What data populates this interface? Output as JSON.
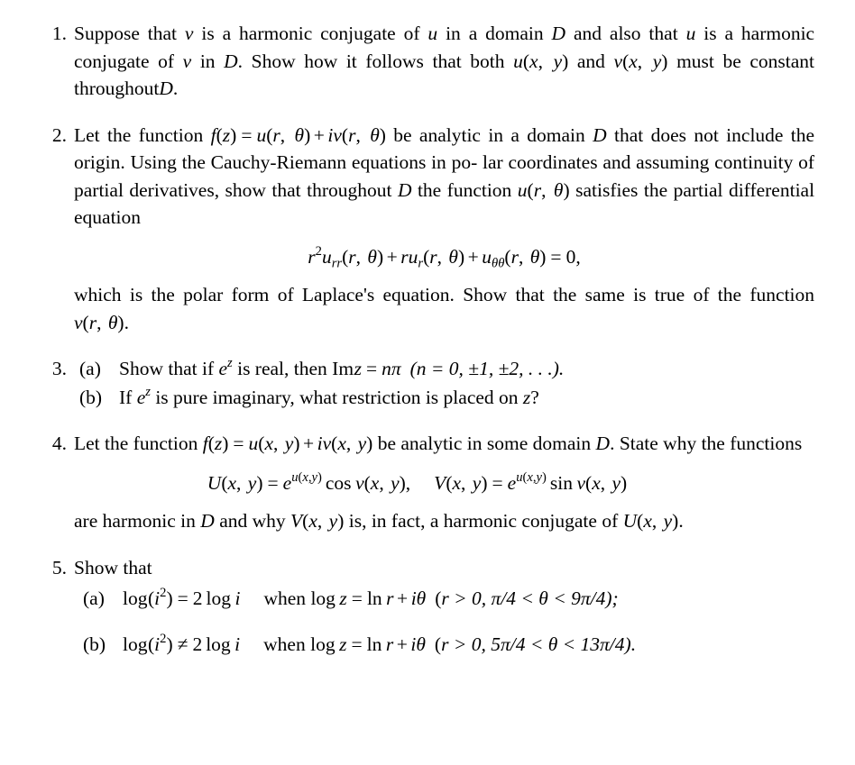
{
  "document": {
    "type": "math-problem-set",
    "subject": "complex-analysis",
    "background_color": "#ffffff",
    "text_color": "#000000"
  },
  "problems": [
    {
      "number": "1.",
      "text_plain": "Suppose that v is a harmonic conjugate of u in a domain D and also that u is a harmonic conjugate of v in D. Show how it follows that both u(x, y) and v(x, y) must be constant throughout D.",
      "lines": [
        "Suppose that v is a harmonic conjugate of u in a domain D and also that",
        "u is a harmonic conjugate of v in D. Show how it follows that both u(x, y)",
        "and v(x, y) must be constant throughout D."
      ],
      "segments": {
        "l1_a": "Suppose that",
        "l1_v": "v",
        "l1_b": "is a harmonic conjugate of",
        "l1_u": "u",
        "l1_c": "in a domain",
        "l1_D": "D",
        "l1_d": "and also that",
        "l2_u": "u",
        "l2_a": "is a harmonic conjugate of",
        "l2_v": "v",
        "l2_b": "in",
        "l2_D": "D",
        "l2_c": ". Show how it follows that both",
        "l3_a": "and",
        "l3_b": "must be constant throughout",
        "l3_D": "D",
        "l3_period": "."
      }
    },
    {
      "number": "2.",
      "text_plain": "Let the function f(z) = u(r, θ) + iv(r, θ) be analytic in a domain D that does not include the origin. Using the Cauchy-Riemann equations in polar coordinates and assuming continuity of partial derivatives, show that throughout D the function u(r, θ) satisfies the partial differential equation",
      "segments": {
        "s1": "Let the function",
        "s2": "be analytic in a domain",
        "s3": "D",
        "s4": "that does not include the origin. Using the Cauchy-Riemann equations in po-",
        "s5": "lar coordinates and assuming continuity of partial derivatives, show that",
        "s6": "throughout",
        "s7": "D",
        "s8": "the function",
        "s9": "satisfies the partial differential equation"
      },
      "equation_plain": "r²u_rr(r, θ) + ru_r(r, θ) + u_θθ(r, θ) = 0,",
      "after_equation": {
        "s1": "which is the polar form of Laplace's equation. Show that the same is true",
        "s2": "of the function",
        "s3": "."
      }
    },
    {
      "number": "3.",
      "subitems": [
        {
          "label": "(a)",
          "text_plain": "Show that if e^z is real, then Im z = nπ  (n = 0, ±1, ±2, ...).",
          "segments": {
            "s1": "Show that if",
            "s2": "is real, then",
            "s3": "Im",
            "s4": "nπ",
            "s5": "(n = 0, ±1, ±2, . . .)."
          }
        },
        {
          "label": "(b)",
          "text_plain": "If e^z is pure imaginary, what restriction is placed on z?",
          "segments": {
            "s1": "If",
            "s2": "is pure imaginary, what restriction is placed on",
            "s3": "?"
          }
        }
      ]
    },
    {
      "number": "4.",
      "text_plain": "Let the function f(z) = u(x, y) + iv(x, y) be analytic in some domain D. State why the functions",
      "segments": {
        "s1": "Let the function",
        "s2": "be analytic in some domain",
        "s3": "D",
        "s4": ".",
        "s5": "State why the functions"
      },
      "equation_plain": "U(x, y) = e^{u(x,y)} cos v(x, y),    V(x, y) = e^{u(x,y)} sin v(x, y)",
      "after_equation": {
        "s1": "are harmonic in",
        "s2": "D",
        "s3": "and why",
        "s4": "is, in fact, a harmonic conjugate of",
        "s5": "."
      }
    },
    {
      "number": "5.",
      "intro": "Show that",
      "subitems": [
        {
          "label": "(a)",
          "text_plain": "log(i²) = 2 log i    when log z = ln r + iθ  (r > 0, π/4 < θ < 9π/4);",
          "segments": {
            "when": "when",
            "cond_open": "(",
            "r_gt": "> 0,",
            "range": "π/4 < θ < 9π/4);"
          }
        },
        {
          "label": "(b)",
          "text_plain": "log(i²) ≠ 2 log i    when log z = ln r + iθ  (r > 0, 5π/4 < θ < 13π/4).",
          "segments": {
            "when": "when",
            "cond_open": "(",
            "r_gt": "> 0,",
            "range": "5π/4 < θ < 13π/4)."
          }
        }
      ]
    }
  ],
  "symbols": {
    "u": "u",
    "v": "v",
    "D": "D",
    "x": "x",
    "y": "y",
    "z": "z",
    "r": "r",
    "theta": "θ",
    "f": "f",
    "i": "i",
    "e": "e",
    "n": "n",
    "U": "U",
    "V": "V",
    "equals": "=",
    "plus": "+",
    "neq": "≠",
    "lt": "<",
    "gt": ">",
    "zero": "0",
    "two": "2",
    "comma": ",",
    "log": "log",
    "ln": "ln",
    "sin": "sin",
    "cos": "cos",
    "Im": "Im",
    "paren_open": "(",
    "paren_close": ")"
  }
}
